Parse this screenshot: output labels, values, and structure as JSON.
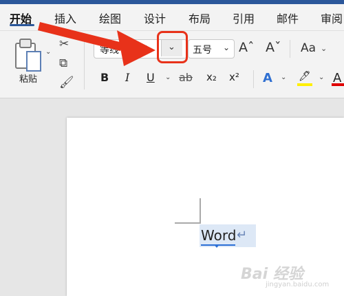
{
  "tabs": [
    "开始",
    "插入",
    "绘图",
    "设计",
    "布局",
    "引用",
    "邮件",
    "审阅"
  ],
  "clipboard": {
    "paste_label": "粘贴"
  },
  "font": {
    "name": "等线 (正文)",
    "dropdown_glyph": "⌄"
  },
  "font_size": {
    "value": "五号",
    "dropdown_glyph": "⌄"
  },
  "size_buttons": {
    "grow": "Aˆ",
    "shrink": "Aˇ"
  },
  "change_case": "Aa",
  "formatting": {
    "bold": "B",
    "italic": "I",
    "underline": "U",
    "strikethrough": "ab",
    "subscript": "x₂",
    "superscript": "x²",
    "text_effects": "A",
    "highlight": "🖊",
    "font_color": "A"
  },
  "document": {
    "text": "Word",
    "return_mark": "↵"
  },
  "watermark": {
    "logo": "Bai 经验",
    "url": "jingyan.baidu.com"
  },
  "colors": {
    "accent": "#2b579a",
    "annotation": "#e8321a",
    "highlight_yellow": "#ffef00",
    "font_color_red": "#e00000",
    "selection": "#dde8f6"
  }
}
